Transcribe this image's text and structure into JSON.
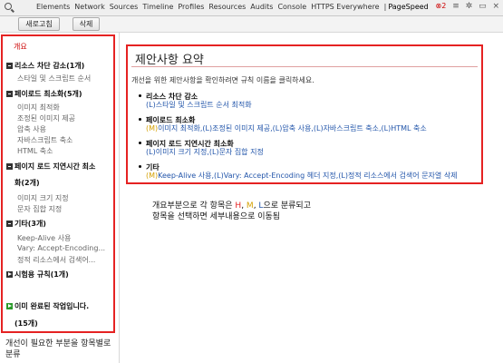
{
  "devtools_tabs": {
    "tabs": [
      "Elements",
      "Network",
      "Sources",
      "Timeline",
      "Profiles",
      "Resources",
      "Audits",
      "Console",
      "HTTPS Everywhere",
      "|",
      "PageSpeed"
    ],
    "active": "PageSpeed",
    "error_count": "2"
  },
  "toolbar": {
    "refresh_label": "새로고침",
    "delete_label": "삭제"
  },
  "sidebar": {
    "overview": "개요",
    "groups": [
      {
        "title": "리소스 차단 감소(1개)",
        "items": [
          "스타일 및 스크립트 순서"
        ]
      },
      {
        "title": "페이로드 최소화(5개)",
        "items": [
          "이미지 최적화",
          "조정된 이미지 제공",
          "압축 사용",
          "자바스크립트 축소",
          "HTML 축소"
        ]
      },
      {
        "title": "페이지 로드 지연시간 최소",
        "title_cont": "화(2개)",
        "items": [
          "이미지 크기 지정",
          "문자 집합 지정"
        ]
      },
      {
        "title": "기타(3개)",
        "items": [
          "Keep-Alive 사용",
          "Vary: Accept-Encoding...",
          "정적 리소스에서 검색어..."
        ]
      },
      {
        "title": "시험용 규칙(1개)",
        "items": []
      }
    ],
    "done_label": "이미 완료된 작업입니다.",
    "done_count": "(15개)",
    "footer_note": "개선이 필요한 부분을 항목별로 분류"
  },
  "summary": {
    "title": "제안사항 요약",
    "intro": "개선을 위한 제안사항을 확인하려면 규칙 이름을 클릭하세요.",
    "rules": [
      {
        "heading": "리소스 차단 감소",
        "links": [
          {
            "level": "(L)",
            "text": "스타일 및 스크립트 순서 최적화"
          }
        ]
      },
      {
        "heading": "페이로드 최소화",
        "links": [
          {
            "level": "(M)",
            "text": "이미지 최적화,"
          },
          {
            "level": "(L)",
            "text": "조정된 이미지 제공,"
          },
          {
            "level": "(L)",
            "text": "압축 사용,"
          },
          {
            "level": "(L)",
            "text": "자바스크립트 축소,"
          },
          {
            "level": "(L)",
            "text": "HTML 축소"
          }
        ]
      },
      {
        "heading": "페이지 로드 지연시간 최소화",
        "links": [
          {
            "level": "(L)",
            "text": "이미지 크기 지정,"
          },
          {
            "level": "(L)",
            "text": "문자 집합 지정"
          }
        ]
      },
      {
        "heading": "기타",
        "links": [
          {
            "level": "(M)",
            "text": "Keep-Alive 사용,"
          },
          {
            "level": "(L)",
            "text": "Vary: Accept-Encoding 헤더 지정,"
          },
          {
            "level": "(L)",
            "text": "정적 리소스에서 검색어 문자열 삭제"
          }
        ]
      }
    ]
  },
  "note": {
    "line1_prefix": "개요부분으로 각 항목은",
    "h": "H",
    "m": "M",
    "l": "L",
    "line1_suffix": "으로 분류되고",
    "line2": "항목을 선택하면 세부내용으로 이동됨"
  },
  "colors": {
    "highlight_border": "#e52222",
    "link": "#2255aa",
    "medium": "#d4a000"
  }
}
